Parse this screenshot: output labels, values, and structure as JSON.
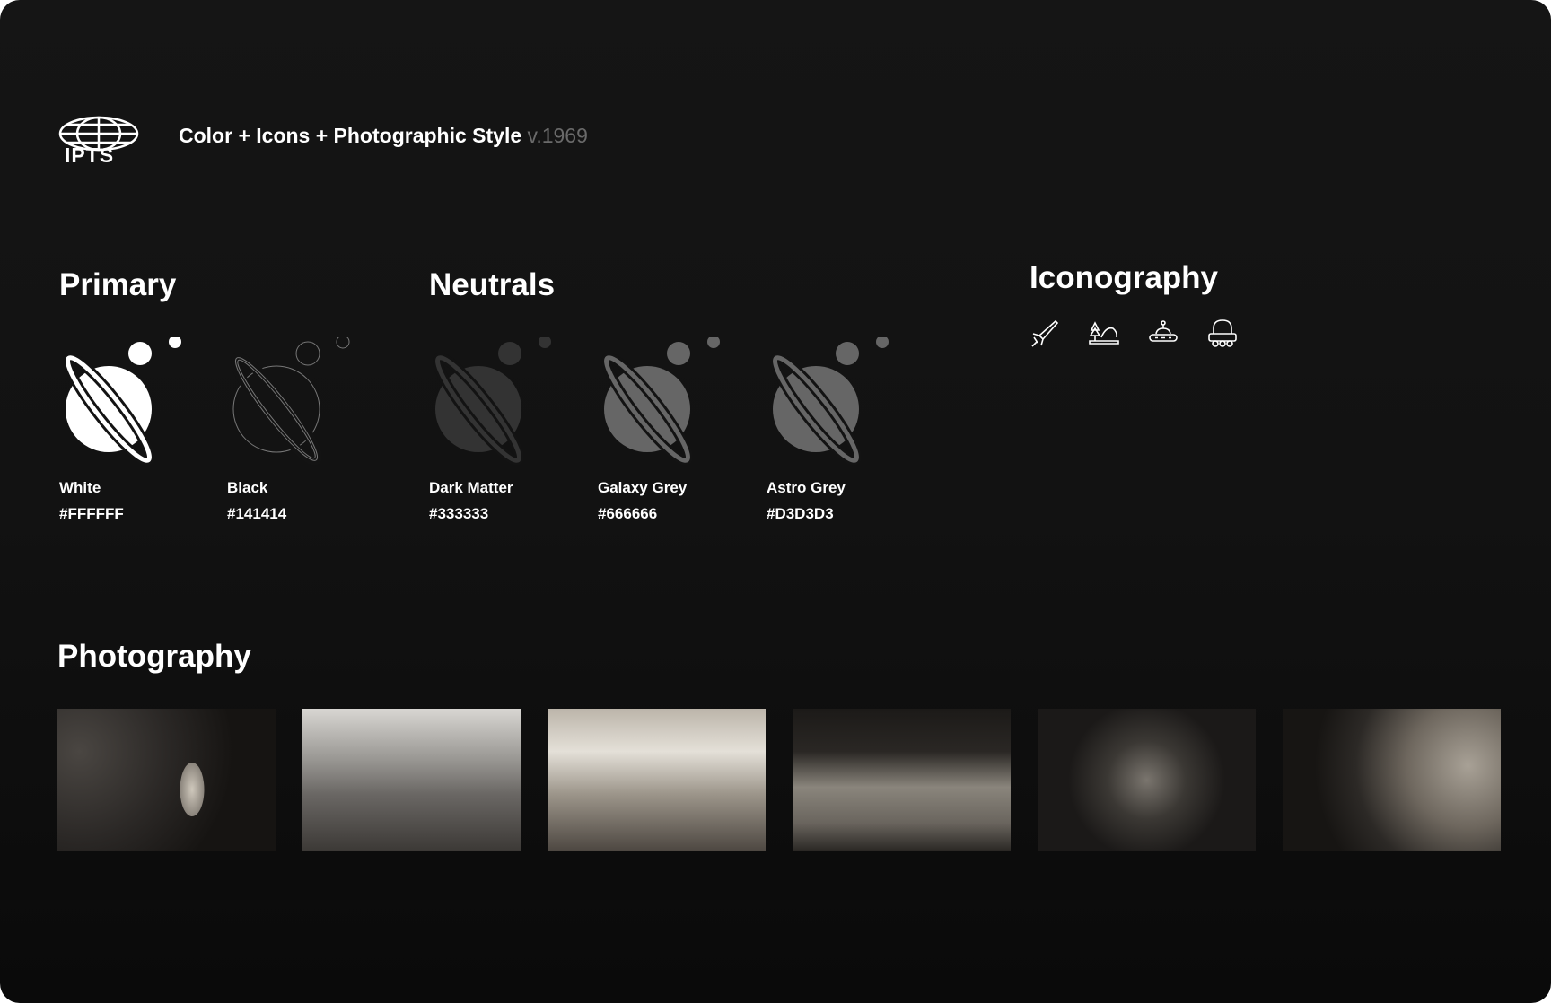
{
  "header": {
    "logo_text": "IPTS",
    "title": "Color + Icons + Photographic Style",
    "version": "v.1969"
  },
  "sections": {
    "primary": "Primary",
    "neutrals": "Neutrals",
    "iconography": "Iconography",
    "photography": "Photography"
  },
  "colors": [
    {
      "name": "White",
      "hex": "#FFFFFF"
    },
    {
      "name": "Black",
      "hex": "#141414"
    },
    {
      "name": "Dark Matter",
      "hex": "#333333"
    },
    {
      "name": "Galaxy Grey",
      "hex": "#666666"
    },
    {
      "name": "Astro Grey",
      "hex": "#D3D3D3"
    }
  ],
  "icons": [
    "rocket-icon",
    "landscape-ufo-icon",
    "ufo-icon",
    "rover-icon"
  ],
  "photos": [
    "satellite-over-moon",
    "astronaut-on-cliff",
    "radar-dish-rover",
    "astronauts-on-surface",
    "space-station",
    "gas-giant-planet"
  ]
}
